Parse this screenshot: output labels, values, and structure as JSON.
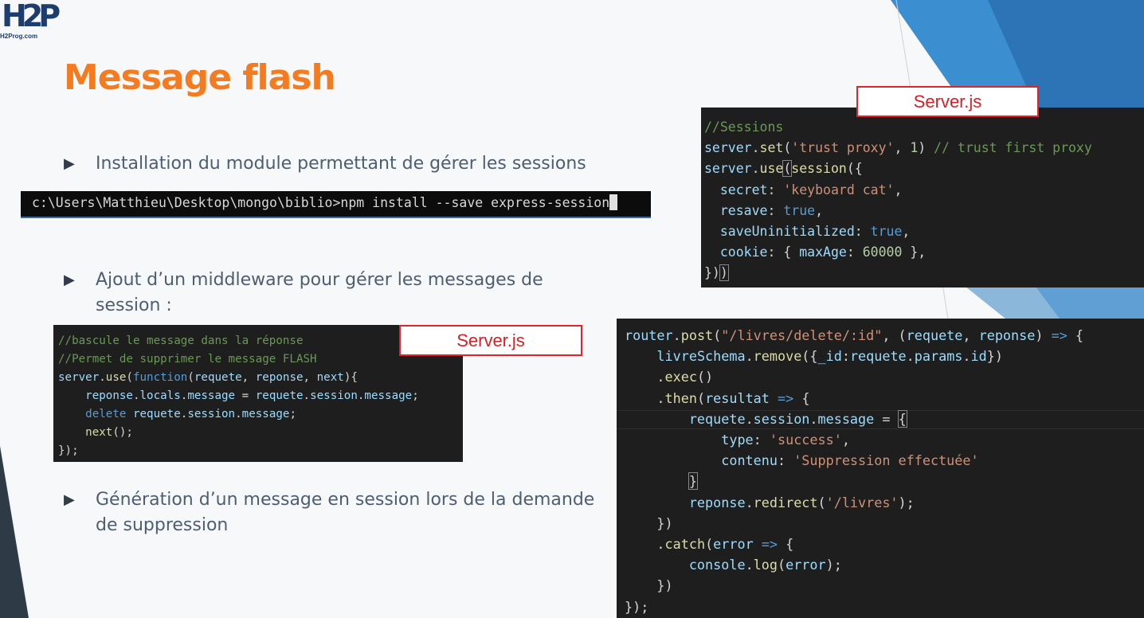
{
  "logo": {
    "mark": "H2P",
    "text": "H2Prog.com"
  },
  "slide": {
    "title": "Message flash",
    "bullets": [
      {
        "lines": [
          "Installation du module permettant de gérer les sessions"
        ]
      },
      {
        "lines": [
          "Ajout d’un middleware pour gérer les messages de",
          "session :"
        ]
      },
      {
        "lines": [
          "Génération d’un message en session lors de la demande",
          "de suppression"
        ]
      }
    ]
  },
  "terminal": {
    "command": "c:\\Users\\Matthieu\\Desktop\\mongo\\biblio>npm install --save express-session"
  },
  "labels": {
    "server_top": "Server.js",
    "server_mid": "Server.js"
  },
  "code_sessions": [
    "//Sessions",
    "server.set('trust proxy', 1) // trust first proxy",
    "server.use(session({",
    "  secret: 'keyboard cat',",
    "  resave: true,",
    "  saveUninitialized: true,",
    "  cookie: { maxAge: 60000 },",
    "}))"
  ],
  "code_middleware": [
    "//bascule le message dans la réponse",
    "//Permet de supprimer le message FLASH",
    "server.use(function(requete, reponse, next){",
    "    reponse.locals.message = requete.session.message;",
    "    delete requete.session.message;",
    "    next();",
    "});"
  ],
  "code_delete_route": [
    "router.post(\"/livres/delete/:id\", (requete, reponse) => {",
    "    livreSchema.remove({_id:requete.params.id})",
    "    .exec()",
    "    .then(resultat => {",
    "        requete.session.message = {",
    "            type: 'success',",
    "            contenu: 'Suppression effectuée'",
    "        }",
    "        reponse.redirect('/livres');",
    "    })",
    "    .catch(error => {",
    "        console.log(error);",
    "    })",
    "});"
  ],
  "colors": {
    "title": "#f47b20",
    "text": "#4d5e70",
    "label_border": "#e0242b",
    "accent": "#2f7fc1",
    "dark": "#2e3b47"
  }
}
